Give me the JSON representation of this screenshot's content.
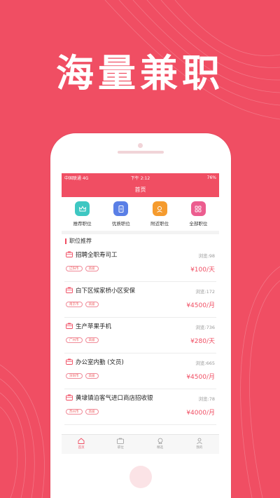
{
  "headline": "海量兼职",
  "status": {
    "carrier": "中国联通  4G",
    "time": "下午 2:12",
    "battery": "76%"
  },
  "nav": {
    "title": "首页"
  },
  "categories": [
    {
      "label": "推荐职位",
      "icon": "crown-icon",
      "color": "#3ec7c2"
    },
    {
      "label": "优质职位",
      "icon": "document-icon",
      "color": "#5a7fe6"
    },
    {
      "label": "附近职位",
      "icon": "location-icon",
      "color": "#f59b2e"
    },
    {
      "label": "全部职位",
      "icon": "grid-icon",
      "color": "#ec5d8f"
    }
  ],
  "section_title": "职位推荐",
  "jobs": [
    {
      "title": "招聘全职寿司工",
      "views": "浏览:98",
      "city": "辽阳市",
      "level": "高级",
      "pay": "¥100/天"
    },
    {
      "title": "白下区候家桥小区安保",
      "views": "浏览:172",
      "city": "南京市",
      "level": "高级",
      "pay": "¥4500/月"
    },
    {
      "title": "生产苹果手机",
      "views": "浏览:736",
      "city": "广州市",
      "level": "高级",
      "pay": "¥280/天"
    },
    {
      "title": "办公室内勤 (文员)",
      "views": "浏览:665",
      "city": "深圳市",
      "level": "高级",
      "pay": "¥4500/月"
    },
    {
      "title": "黄埭镇泊客气进口商店招收银",
      "views": "浏览:78",
      "city": "苏州市",
      "level": "高级",
      "pay": "¥4000/月"
    }
  ],
  "tabs": [
    {
      "label": "首页",
      "icon": "home-icon",
      "active": true
    },
    {
      "label": "职位",
      "icon": "briefcase-icon",
      "active": false
    },
    {
      "label": "精选",
      "icon": "badge-icon",
      "active": false
    },
    {
      "label": "我的",
      "icon": "user-icon",
      "active": false
    }
  ],
  "colors": {
    "brand": "#f04e63",
    "white": "#ffffff"
  }
}
